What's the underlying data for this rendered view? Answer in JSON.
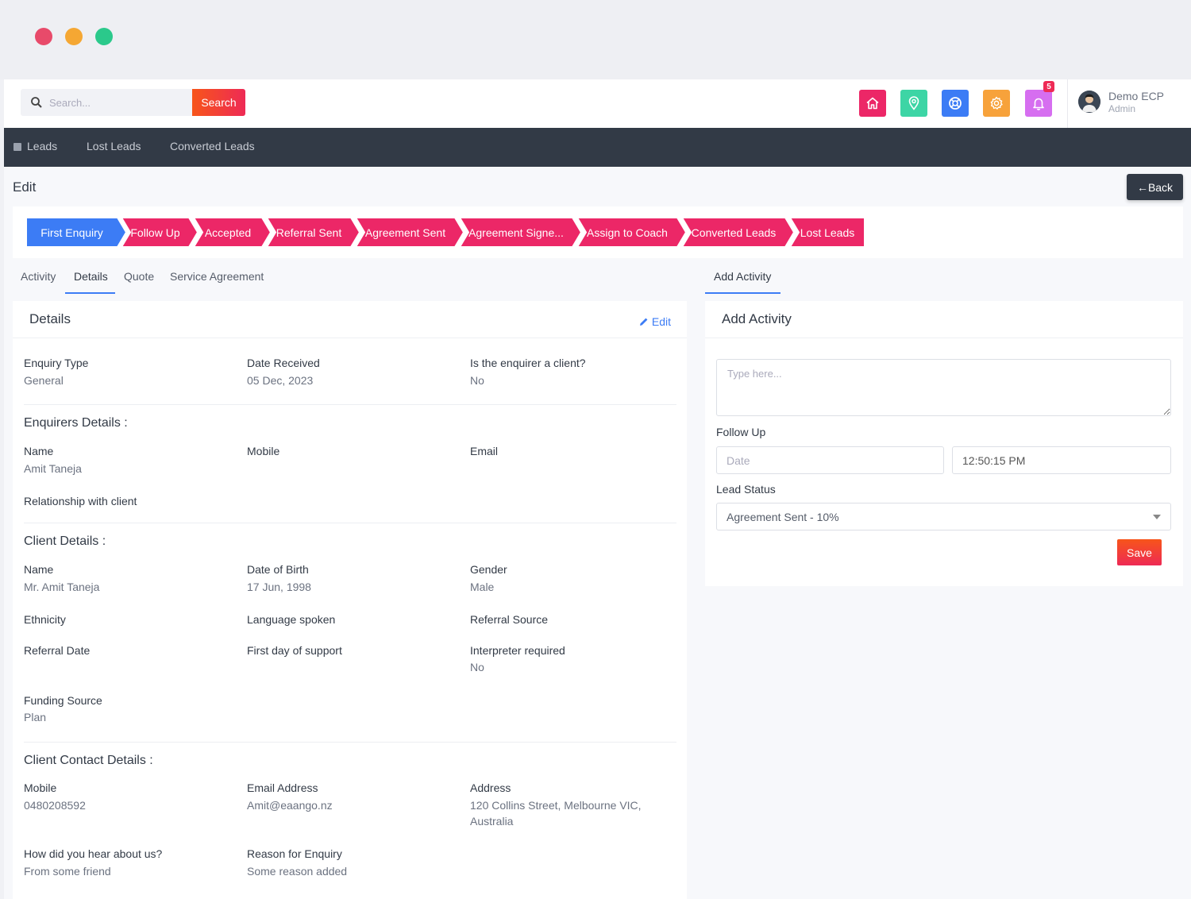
{
  "search": {
    "placeholder": "Search...",
    "button_label": "Search"
  },
  "topbar": {
    "icons": [
      {
        "name": "home-icon",
        "color": "#ec2767"
      },
      {
        "name": "location-pin-icon",
        "color": "#3dd5a5"
      },
      {
        "name": "support-icon",
        "color": "#3c7cf5"
      },
      {
        "name": "gear-icon",
        "color": "#f7a23b"
      },
      {
        "name": "bell-icon",
        "color": "#d66ef0"
      }
    ],
    "notification_count": "5",
    "user": {
      "name": "Demo ECP",
      "role": "Admin"
    }
  },
  "nav": {
    "items": [
      "Leads",
      "Lost Leads",
      "Converted Leads"
    ]
  },
  "page": {
    "title": "Edit",
    "back_label": "Back"
  },
  "pipeline": {
    "steps": [
      {
        "label": "First Enquiry",
        "active": true
      },
      {
        "label": "Follow Up",
        "active": false
      },
      {
        "label": "Accepted",
        "active": false
      },
      {
        "label": "Referral Sent",
        "active": false
      },
      {
        "label": "Agreement Sent",
        "active": false
      },
      {
        "label": "Agreement Signe...",
        "active": false
      },
      {
        "label": "Assign to Coach",
        "active": false
      },
      {
        "label": "Converted Leads",
        "active": false
      },
      {
        "label": "Lost Leads",
        "active": false
      }
    ]
  },
  "tabs": {
    "items": [
      "Activity",
      "Details",
      "Quote",
      "Service Agreement"
    ],
    "active": "Details",
    "right_tab": "Add Activity"
  },
  "details": {
    "title": "Details",
    "edit_label": "Edit",
    "enquiry": [
      {
        "label": "Enquiry Type",
        "value": "General"
      },
      {
        "label": "Date Received",
        "value": "05 Dec, 2023"
      },
      {
        "label": "Is the enquirer a client?",
        "value": "No"
      }
    ],
    "enquirers_title": "Enquirers Details :",
    "enquirers": [
      {
        "label": "Name",
        "value": "Amit Taneja"
      },
      {
        "label": "Mobile",
        "value": ""
      },
      {
        "label": "Email",
        "value": ""
      },
      {
        "label": "Relationship with client",
        "value": ""
      }
    ],
    "client_title": "Client Details :",
    "client": [
      {
        "label": "Name",
        "value": "Mr. Amit Taneja"
      },
      {
        "label": "Date of Birth",
        "value": "17 Jun, 1998"
      },
      {
        "label": "Gender",
        "value": "Male"
      },
      {
        "label": "Ethnicity",
        "value": ""
      },
      {
        "label": "Language spoken",
        "value": ""
      },
      {
        "label": "Referral Source",
        "value": ""
      },
      {
        "label": "Referral Date",
        "value": ""
      },
      {
        "label": "First day of support",
        "value": ""
      },
      {
        "label": "Interpreter required",
        "value": "No"
      },
      {
        "label": "Funding Source",
        "value": "Plan"
      }
    ],
    "contact_title": "Client Contact Details :",
    "contact": [
      {
        "label": "Mobile",
        "value": "0480208592"
      },
      {
        "label": "Email Address",
        "value": "Amit@eaango.nz"
      },
      {
        "label": "Address",
        "value_line1": "120 Collins Street, Melbourne VIC,",
        "value_line2": "Australia"
      },
      {
        "label": "How did you hear about us?",
        "value": "From some friend"
      },
      {
        "label": "Reason for Enquiry",
        "value": "Some reason added"
      }
    ]
  },
  "activity": {
    "title": "Add Activity",
    "textarea_placeholder": "Type here...",
    "follow_up_label": "Follow Up",
    "date_placeholder": "Date",
    "time_value": "12:50:15 PM",
    "lead_status_label": "Lead Status",
    "lead_status_value": "Agreement Sent - 10%",
    "save_label": "Save"
  },
  "colors": {
    "accent_blue": "#3c7cf5",
    "pipeline_pink": "#ec2767",
    "nav_dark": "#323a46"
  }
}
